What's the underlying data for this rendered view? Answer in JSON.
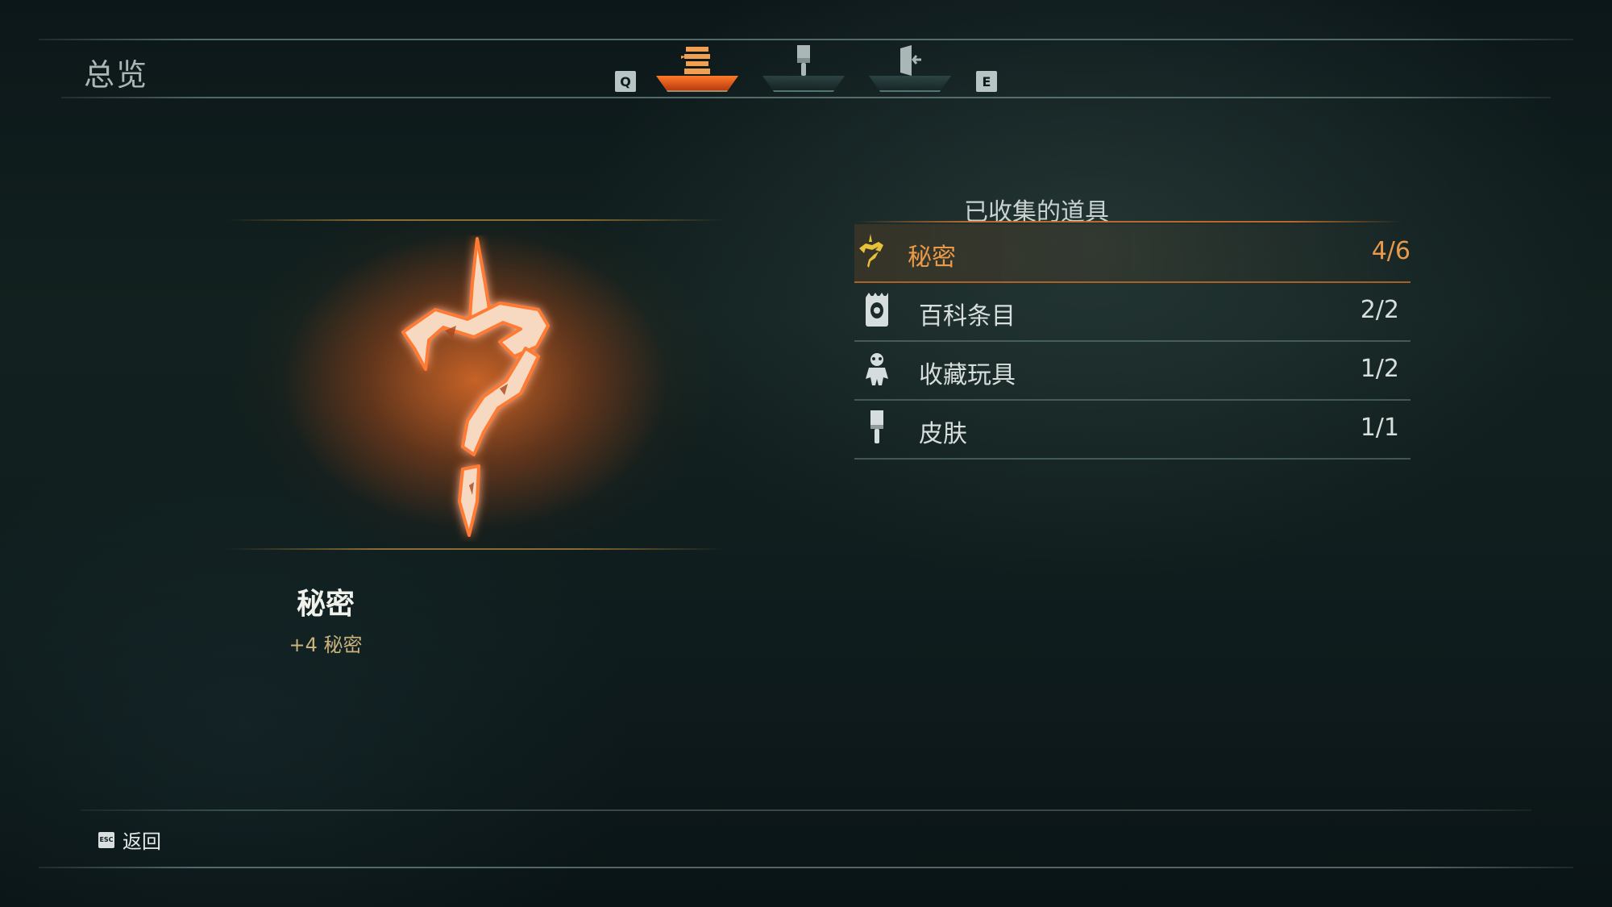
{
  "header": {
    "title": "总览",
    "key_prev": "Q",
    "key_next": "E",
    "tabs": [
      {
        "icon": "overview-stack-icon",
        "active": true
      },
      {
        "icon": "brush-icon",
        "active": false
      },
      {
        "icon": "exit-door-icon",
        "active": false
      }
    ]
  },
  "feature": {
    "icon": "secret-question-rune-icon",
    "name": "秘密",
    "description": "+4 秘密"
  },
  "collected": {
    "title": "已收集的道具",
    "items": [
      {
        "icon": "secret-rune-icon",
        "label": "秘密",
        "count": "4/6",
        "selected": true
      },
      {
        "icon": "encyclopedia-icon",
        "label": "百科条目",
        "count": "2/2",
        "selected": false
      },
      {
        "icon": "toy-figure-icon",
        "label": "收藏玩具",
        "count": "1/2",
        "selected": false
      },
      {
        "icon": "skin-brush-icon",
        "label": "皮肤",
        "count": "1/1",
        "selected": false
      }
    ]
  },
  "footer": {
    "back_key": "ESC",
    "back_label": "返回"
  },
  "colors": {
    "accent_orange": "#e89a4a",
    "glow_orange": "#ff7a28",
    "text_light": "#d7dedc",
    "background": "#0d1a1c"
  }
}
